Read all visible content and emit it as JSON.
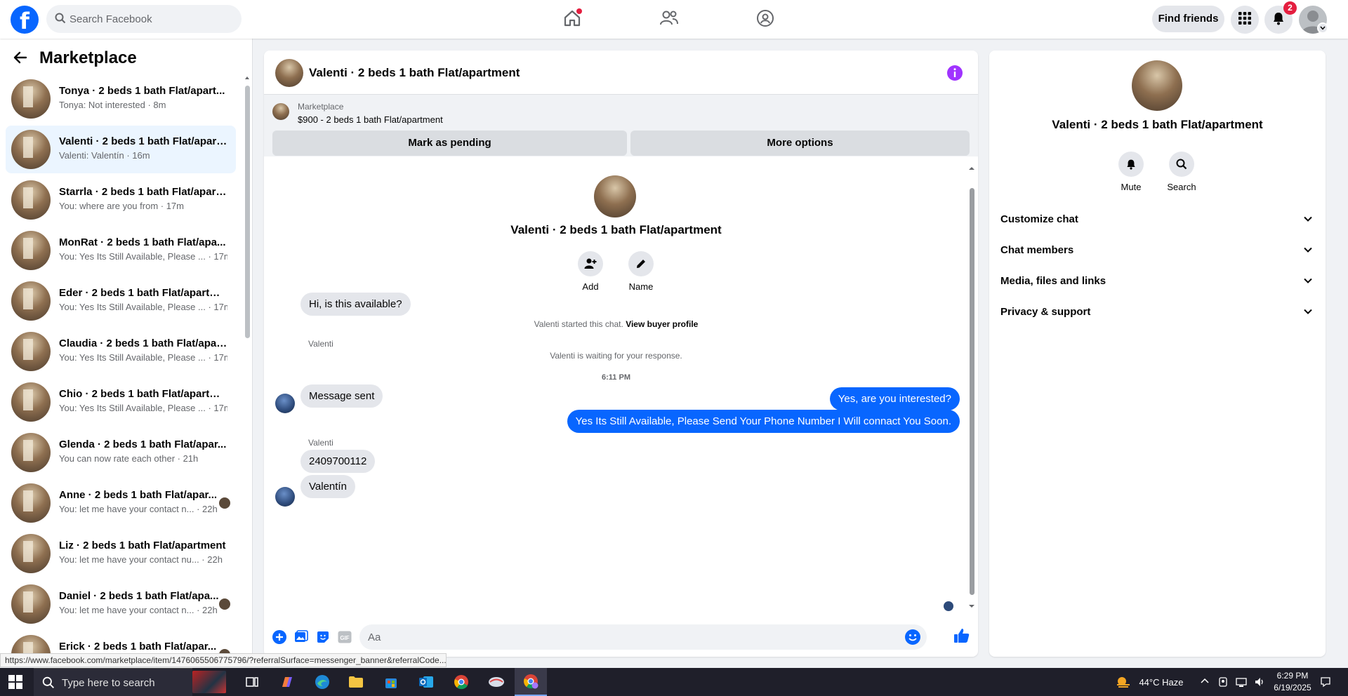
{
  "topbar": {
    "search_placeholder": "Search Facebook",
    "find_friends": "Find friends",
    "notifications_count": "2",
    "logo": "f",
    "accent": "#0866ff"
  },
  "left": {
    "title": "Marketplace",
    "conversations": [
      {
        "title": "Tonya · 2 beds 1 bath Flat/apart...",
        "sub": "Tonya: Not interested · 8m",
        "active": false
      },
      {
        "title": "Valenti · 2 beds 1 bath Flat/apart...",
        "sub": "Valenti: Valentín · 16m",
        "active": true
      },
      {
        "title": "Starrla · 2 beds 1 bath Flat/apart...",
        "sub": "You: where are you from · 17m",
        "active": false
      },
      {
        "title": "MonRat · 2 beds 1 bath Flat/apa...",
        "sub": "You: Yes Its Still Available, Please ... · 17m",
        "active": false
      },
      {
        "title": "Eder · 2 beds 1 bath Flat/apartm...",
        "sub": "You: Yes Its Still Available, Please ... · 17m",
        "active": false
      },
      {
        "title": "Claudia · 2 beds 1 bath Flat/apar...",
        "sub": "You: Yes Its Still Available, Please ... · 17m",
        "active": false
      },
      {
        "title": "Chio · 2 beds 1 bath Flat/apartm...",
        "sub": "You: Yes Its Still Available, Please ... · 17m",
        "active": false
      },
      {
        "title": "Glenda · 2 beds 1 bath Flat/apar...",
        "sub": "You can now rate each other · 21h",
        "active": false
      },
      {
        "title": "Anne · 2 beds 1 bath Flat/apar...",
        "sub": "You: let me have your contact n... · 22h",
        "active": false
      },
      {
        "title": "Liz · 2 beds 1 bath Flat/apartment",
        "sub": "You: let me have your contact nu... · 22h",
        "active": false
      },
      {
        "title": "Daniel · 2 beds 1 bath Flat/apa...",
        "sub": "You: let me have your contact n... · 22h",
        "active": false
      },
      {
        "title": "Erick · 2 beds 1 bath Flat/apar...",
        "sub": "",
        "active": false
      }
    ]
  },
  "chat": {
    "title": "Valenti · 2 beds 1 bath Flat/apartment",
    "marketplace_label": "Marketplace",
    "listing": "$900 - 2 beds 1 bath Flat/apartment",
    "mark_pending": "Mark as pending",
    "more_options": "More options",
    "intro_title": "Valenti · 2 beds 1 bath Flat/apartment",
    "add_label": "Add",
    "name_label": "Name",
    "started_text": "Valenti started this chat.",
    "view_profile": "View buyer profile",
    "sender1": "Valenti",
    "msg1": "Hi, is this available?",
    "msg2": "Message sent",
    "waiting": "Valenti is waiting for your response.",
    "time": "6:11 PM",
    "out1": "Yes, are you interested?",
    "out2": "Yes Its Still Available, Please Send Your Phone Number I Will connact You Soon.",
    "sender2": "Valenti",
    "msg3": "2409700112",
    "msg4": "Valentín",
    "composer_placeholder": "Aa"
  },
  "right": {
    "title": "Valenti · 2 beds 1 bath Flat/apartment",
    "mute": "Mute",
    "search": "Search",
    "sections": [
      "Customize chat",
      "Chat members",
      "Media, files and links",
      "Privacy & support"
    ]
  },
  "status_url": "https://www.facebook.com/marketplace/item/1476065506775796/?referralSurface=messenger_banner&referralCode...",
  "taskbar": {
    "search_placeholder": "Type here to search",
    "weather": "44°C  Haze",
    "time": "6:29 PM",
    "date": "6/19/2025"
  }
}
